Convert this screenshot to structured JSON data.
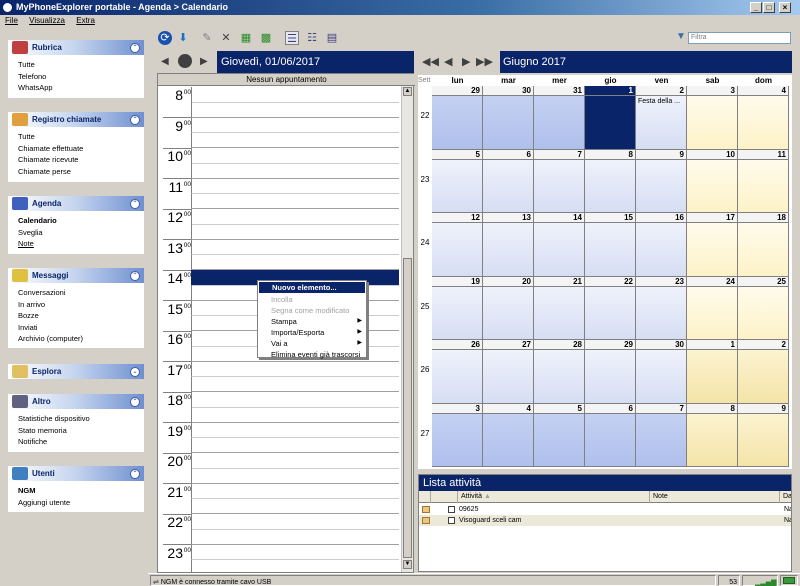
{
  "window": {
    "title": "MyPhoneExplorer portable - Agenda > Calendario",
    "minimize": "_",
    "maximize": "□",
    "close": "×"
  },
  "menu": [
    {
      "label": "File"
    },
    {
      "label": "Visualizza"
    },
    {
      "label": "Extra"
    }
  ],
  "sidebar": {
    "rubrica": {
      "title": "Rubrica",
      "items": [
        "Tutte",
        "Telefono",
        "WhatsApp"
      ]
    },
    "registro": {
      "title": "Registro chiamate",
      "items": [
        "Tutte",
        "Chiamate effettuate",
        "Chiamate ricevute",
        "Chiamate perse"
      ]
    },
    "agenda": {
      "title": "Agenda",
      "items": [
        "Calendario",
        "Sveglia",
        "Note"
      ]
    },
    "messaggi": {
      "title": "Messaggi",
      "items": [
        "Conversazioni",
        "In arrivo",
        "Bozze",
        "Inviati",
        "Archivio (computer)"
      ]
    },
    "esplora": {
      "title": "Esplora"
    },
    "altro": {
      "title": "Altro",
      "items": [
        "Statistiche dispositivo",
        "Stato memoria",
        "Notifiche"
      ]
    },
    "utenti": {
      "title": "Utenti",
      "items": [
        "NGM",
        "Aggiungi utente"
      ]
    }
  },
  "filter": {
    "placeholder": "Filtra"
  },
  "day_view": {
    "title": "Giovedì, 01/06/2017",
    "no_appointments": "Nessun appuntamento",
    "hours": [
      "8",
      "9",
      "10",
      "11",
      "12",
      "13",
      "14",
      "15",
      "16",
      "17",
      "18",
      "19",
      "20",
      "21",
      "22",
      "23"
    ],
    "minutes": "00"
  },
  "context_menu": [
    {
      "label": "Nuovo elemento...",
      "state": "selected"
    },
    {
      "label": "Incolla",
      "state": "disabled"
    },
    {
      "label": "Segna come modificato",
      "state": "disabled"
    },
    {
      "label": "Stampa",
      "state": "normal",
      "submenu": true
    },
    {
      "label": "Importa/Esporta",
      "state": "normal",
      "submenu": true
    },
    {
      "label": "Vai a",
      "state": "normal",
      "submenu": true
    },
    {
      "label": "Elimina eventi già trascorsi",
      "state": "normal"
    }
  ],
  "month_view": {
    "title": "Giugno 2017",
    "week_header": "Sett",
    "days_of_week": [
      "lun",
      "mar",
      "mer",
      "gio",
      "ven",
      "sab",
      "dom"
    ],
    "weeks": [
      {
        "num": "22",
        "days": [
          "29",
          "30",
          "31",
          "1",
          "2",
          "3",
          "4"
        ]
      },
      {
        "num": "23",
        "days": [
          "5",
          "6",
          "7",
          "8",
          "9",
          "10",
          "11"
        ]
      },
      {
        "num": "24",
        "days": [
          "12",
          "13",
          "14",
          "15",
          "16",
          "17",
          "18"
        ]
      },
      {
        "num": "25",
        "days": [
          "19",
          "20",
          "21",
          "22",
          "23",
          "24",
          "25"
        ]
      },
      {
        "num": "26",
        "days": [
          "26",
          "27",
          "28",
          "29",
          "30",
          "1",
          "2"
        ]
      },
      {
        "num": "27",
        "days": [
          "3",
          "4",
          "5",
          "6",
          "7",
          "8",
          "9"
        ]
      }
    ],
    "event": "Festa della ..."
  },
  "tasks": {
    "title": "Lista attività",
    "columns": [
      "Attività",
      "Note",
      "Dat"
    ],
    "rows": [
      {
        "name": "09625",
        "date": "Na"
      },
      {
        "name": "Visoguard sceli cam",
        "date": "Na"
      }
    ]
  },
  "status": {
    "connection": "NGM è connesso tramite cavo USB",
    "battery": "53"
  },
  "colors": {
    "accent": "#0a246a",
    "weekday_cell": "#c8d4f4",
    "weekend_cell": "#fdf6d8",
    "selected_cell": "#0a246a"
  }
}
